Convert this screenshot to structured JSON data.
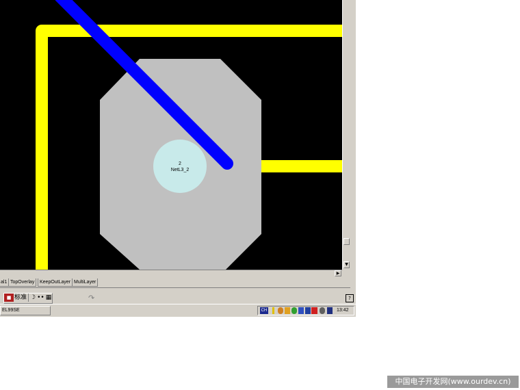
{
  "pad": {
    "number": "2",
    "net": "NetL3_2"
  },
  "layer_tabs": [
    "al1",
    "TopOverlay",
    "KeepOutLayer",
    "MultiLayer"
  ],
  "ime": {
    "mode_label": "标准",
    "moon": "☽",
    "punct": "••",
    "keyboard": "▦"
  },
  "taskbar": {
    "window_button": "EL99SE",
    "tray_lang": "CH",
    "clock": "13:42"
  },
  "icons": {
    "curve": "↷",
    "help": "?",
    "arrow_down": "▼",
    "arrow_right": "▶"
  },
  "watermark": "中国电子开发网(www.ourdev.cn)",
  "colors": {
    "board_background": "#000000",
    "top_track": "#ffff00",
    "bottom_track": "#0000ff",
    "pad_copper": "#c0c0c0",
    "pad_hole": "#c8eaea",
    "window_face": "#d4d0c8"
  }
}
